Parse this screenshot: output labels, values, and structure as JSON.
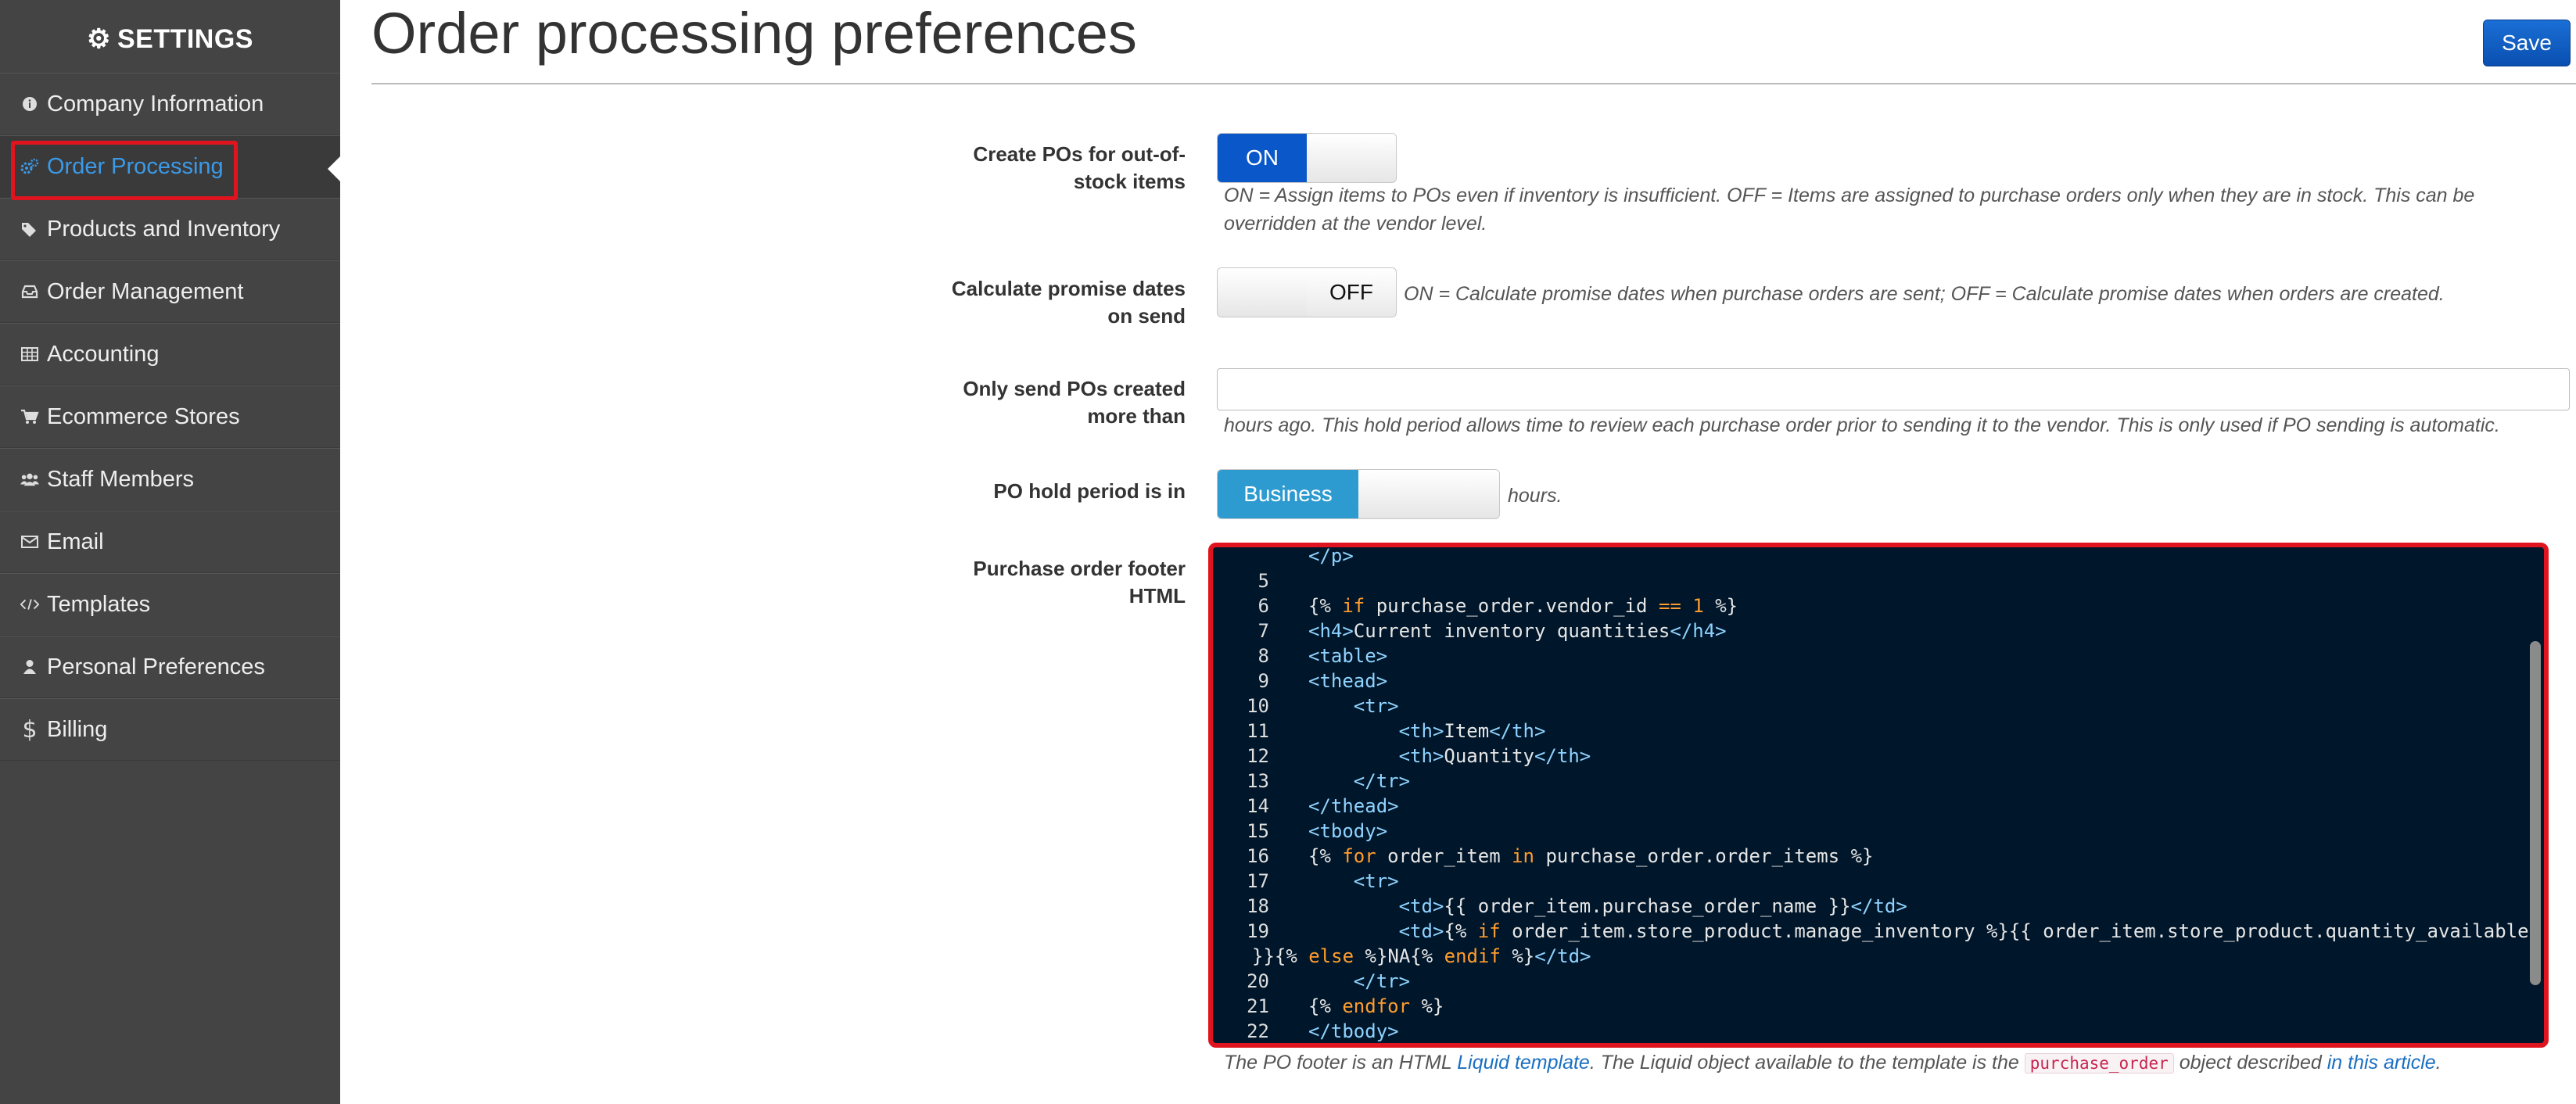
{
  "sidebar": {
    "title": "SETTINGS",
    "items": [
      {
        "label": "Company Information",
        "icon": "info-icon"
      },
      {
        "label": "Order Processing",
        "icon": "cogs-icon"
      },
      {
        "label": "Products and Inventory",
        "icon": "tags-icon"
      },
      {
        "label": "Order Management",
        "icon": "inbox-icon"
      },
      {
        "label": "Accounting",
        "icon": "table-icon"
      },
      {
        "label": "Ecommerce Stores",
        "icon": "cart-icon"
      },
      {
        "label": "Staff Members",
        "icon": "users-icon"
      },
      {
        "label": "Email",
        "icon": "envelope-icon"
      },
      {
        "label": "Templates",
        "icon": "code-icon"
      },
      {
        "label": "Personal Preferences",
        "icon": "user-icon"
      },
      {
        "label": "Billing",
        "icon": "dollar-icon"
      }
    ],
    "active_item": "Order Processing"
  },
  "header": {
    "title": "Order processing preferences",
    "save_label": "Save"
  },
  "fields": {
    "create_pos": {
      "label_line1": "Create POs for out-of-",
      "label_line2": "stock items",
      "toggle_on": "ON",
      "value": "ON",
      "help_line1": "ON = Assign items to POs even if inventory is insufficient. OFF = Items are assigned to purchase orders only when they are in stock. This can be",
      "help_line2": "overridden at the vendor level."
    },
    "promise_dates": {
      "label_line1": "Calculate promise dates",
      "label_line2": "on send",
      "toggle_off": "OFF",
      "value": "OFF",
      "help": "ON = Calculate promise dates when purchase orders are sent; OFF = Calculate promise dates when orders are created."
    },
    "hold_period": {
      "label_line1": "Only send POs created",
      "label_line2": "more than",
      "value": "",
      "help": "hours ago. This hold period allows time to review each purchase order prior to sending it to the vendor. This is only used if PO sending is automatic."
    },
    "hold_units": {
      "label": "PO hold period is in",
      "toggle_on": "Business",
      "value": "Business",
      "suffix": "hours."
    },
    "footer_html": {
      "label_line1": "Purchase order footer",
      "label_line2": "HTML",
      "help_pre": "The PO footer is an HTML ",
      "help_link": "Liquid template",
      "help_mid": ". The Liquid object available to the template is the ",
      "help_code": "purchase_order",
      "help_post": " object described ",
      "help_link2": "in this article",
      "help_end": "."
    }
  },
  "code": {
    "lines": [
      {
        "n": "",
        "text": "</p>"
      },
      {
        "n": "5",
        "text": ""
      },
      {
        "n": "6",
        "text": "{% if purchase_order.vendor_id == 1 %}"
      },
      {
        "n": "7",
        "text": "<h4>Current inventory quantities</h4>"
      },
      {
        "n": "8",
        "text": "<table>"
      },
      {
        "n": "9",
        "text": "<thead>"
      },
      {
        "n": "10",
        "text": "    <tr>"
      },
      {
        "n": "11",
        "text": "        <th>Item</th>"
      },
      {
        "n": "12",
        "text": "        <th>Quantity</th>"
      },
      {
        "n": "13",
        "text": "    </tr>"
      },
      {
        "n": "14",
        "text": "</thead>"
      },
      {
        "n": "15",
        "text": "<tbody>"
      },
      {
        "n": "16",
        "text": "{% for order_item in purchase_order.order_items %}"
      },
      {
        "n": "17",
        "text": "    <tr>"
      },
      {
        "n": "18",
        "text": "        <td>{{ order_item.purchase_order_name }}</td>"
      },
      {
        "n": "19",
        "text": "        <td>{% if order_item.store_product.manage_inventory %}{{ order_item.store_product.quantity_available"
      },
      {
        "n": "",
        "text": "}}{% else %}NA{% endif %}</td>"
      },
      {
        "n": "20",
        "text": "    </tr>"
      },
      {
        "n": "21",
        "text": "{% endfor %}"
      },
      {
        "n": "22",
        "text": "</tbody>"
      }
    ]
  },
  "colors": {
    "sidebar_bg": "#444444",
    "active_link": "#3a9ae8",
    "highlight_border": "#e0141e",
    "toggle_on": "#0a57c9",
    "toggle_business": "#2e9bd0",
    "code_bg": "#00162a"
  }
}
